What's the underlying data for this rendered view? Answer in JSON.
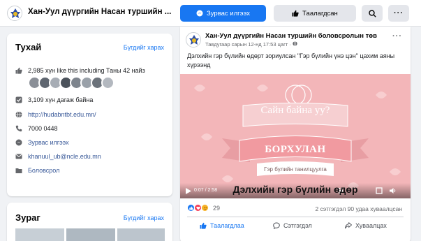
{
  "header": {
    "page_name": "Хан-Уул дүүргийн Насан туршийн ...",
    "message_label": "Зурвас илгээх",
    "like_label": "Таалагдсан",
    "search_icon": "search-icon",
    "more_icon": "more-icon"
  },
  "about": {
    "title": "Тухай",
    "see_all": "Бүгдийг харах",
    "likes_text": "2,985 хүн like this including Таны 42 найз",
    "followers_text": "3,109 хүн дагаж байна",
    "website": "http://hudabntbt.edu.mn/",
    "phone": "7000 0448",
    "message_link": "Зурвас илгээх",
    "email": "khanuul_ub@ncle.edu.mn",
    "category": "Боловсрол"
  },
  "photos": {
    "title": "Зураг",
    "see_all": "Бүгдийг харах"
  },
  "post": {
    "author": "Хан-Уул дүүргийн Насан туршийн боловсролын төв",
    "meta": "Тавдугаар сарын 12-нд 17:53 цагт ·",
    "text": "Дэлхийн гэр бүлийн өдөрт зориулсан \"Гэр бүлийн үнэ цэн\" цахим аяны хүрээнд",
    "video": {
      "greeting": "Сайн байна уу?",
      "name": "БОРХУЛАН",
      "subtitle": "Гэр бүлийн танилцуулга",
      "caption": "Дэлхийн гэр бүлийн өдөр",
      "time": "0:07 / 2:58"
    },
    "reaction_count": "29",
    "stats": "2 сэтгэгдэл  90 удаа хуваалцсан",
    "actions": {
      "like": "Таалагдлаа",
      "comment": "Сэтгэгдэл",
      "share": "Хуваалцах"
    }
  },
  "colors": {
    "accent": "#1877f2",
    "video_bg": "#f3b6b9",
    "like_blue": "#1877f2",
    "love_red": "#f33e58",
    "care_yellow": "#f7b125"
  }
}
